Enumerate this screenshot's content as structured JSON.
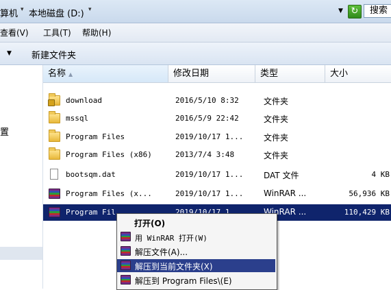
{
  "address": {
    "crumb1": "算机",
    "crumb2": "本地磁盘 (D:)",
    "search_label": "搜索"
  },
  "menu": {
    "view": "查看(V)",
    "tools": "工具(T)",
    "help": "帮助(H)"
  },
  "toolbar": {
    "new_folder": "新建文件夹"
  },
  "nav": {
    "item": "置"
  },
  "columns": {
    "name": "名称",
    "date": "修改日期",
    "type": "类型",
    "size": "大小"
  },
  "files": [
    {
      "name": "download",
      "date": "2016/5/10 8:32",
      "type": "文件夹",
      "size": "",
      "icon": "locked-folder-icon"
    },
    {
      "name": "mssql",
      "date": "2016/5/9 22:42",
      "type": "文件夹",
      "size": "",
      "icon": "folder-icon"
    },
    {
      "name": "Program Files",
      "date": "2019/10/17 1...",
      "type": "文件夹",
      "size": "",
      "icon": "folder-icon"
    },
    {
      "name": "Program Files (x86)",
      "date": "2013/7/4 3:48",
      "type": "文件夹",
      "size": "",
      "icon": "folder-icon"
    },
    {
      "name": "bootsqm.dat",
      "date": "2019/10/17 1...",
      "type": "DAT 文件",
      "size": "4 KB",
      "icon": "file-icon"
    },
    {
      "name": "Program Files (x...",
      "date": "2019/10/17 1...",
      "type": "WinRAR ...",
      "size": "56,936 KB",
      "icon": "rar-icon"
    },
    {
      "name": "Program Fil",
      "date": "2019/10/17 1...",
      "type": "WinRAR ...",
      "size": "110,429 KB",
      "icon": "rar-icon"
    }
  ],
  "context_menu": {
    "open": "打开(O)",
    "open_with_winrar": "用 WinRAR 打开(W)",
    "extract": "解压文件(A)...",
    "extract_here": "解压到当前文件夹(X)",
    "extract_to": "解压到 Program Files\\(E)"
  },
  "colors": {
    "selection": "#0f246c",
    "menu_highlight": "#2b3f8c",
    "folder": "#f0c95a"
  }
}
